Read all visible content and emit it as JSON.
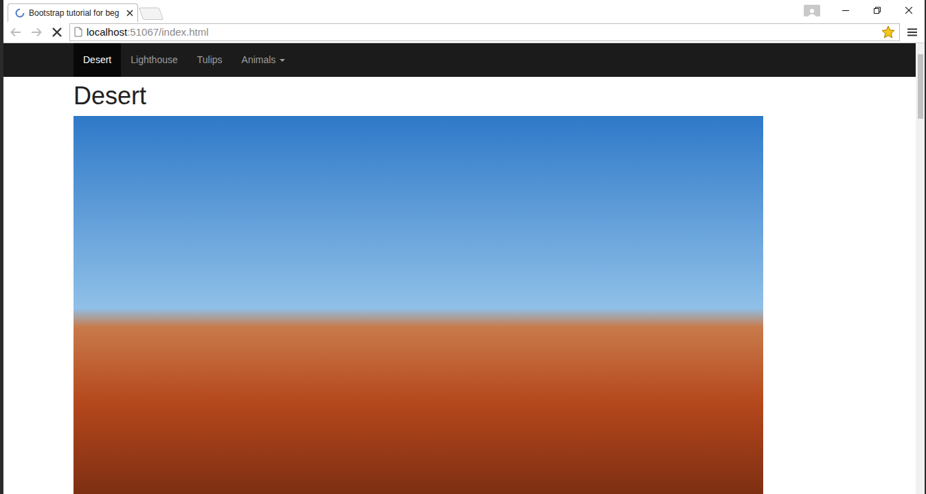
{
  "window": {
    "title": "Bootstrap tutorial for beg",
    "loading": true
  },
  "navigation": {
    "back_disabled": true,
    "forward_disabled": true
  },
  "address": {
    "host": "localhost",
    "rest": ":51067/index.html",
    "bookmarked": true
  },
  "navbar": {
    "items": [
      {
        "label": "Desert",
        "selected": true,
        "kind": "link"
      },
      {
        "label": "Lighthouse",
        "selected": false,
        "kind": "link"
      },
      {
        "label": "Tulips",
        "selected": false,
        "kind": "link"
      },
      {
        "label": "Animals",
        "selected": false,
        "kind": "dropdown"
      }
    ]
  },
  "page": {
    "heading": "Desert"
  }
}
